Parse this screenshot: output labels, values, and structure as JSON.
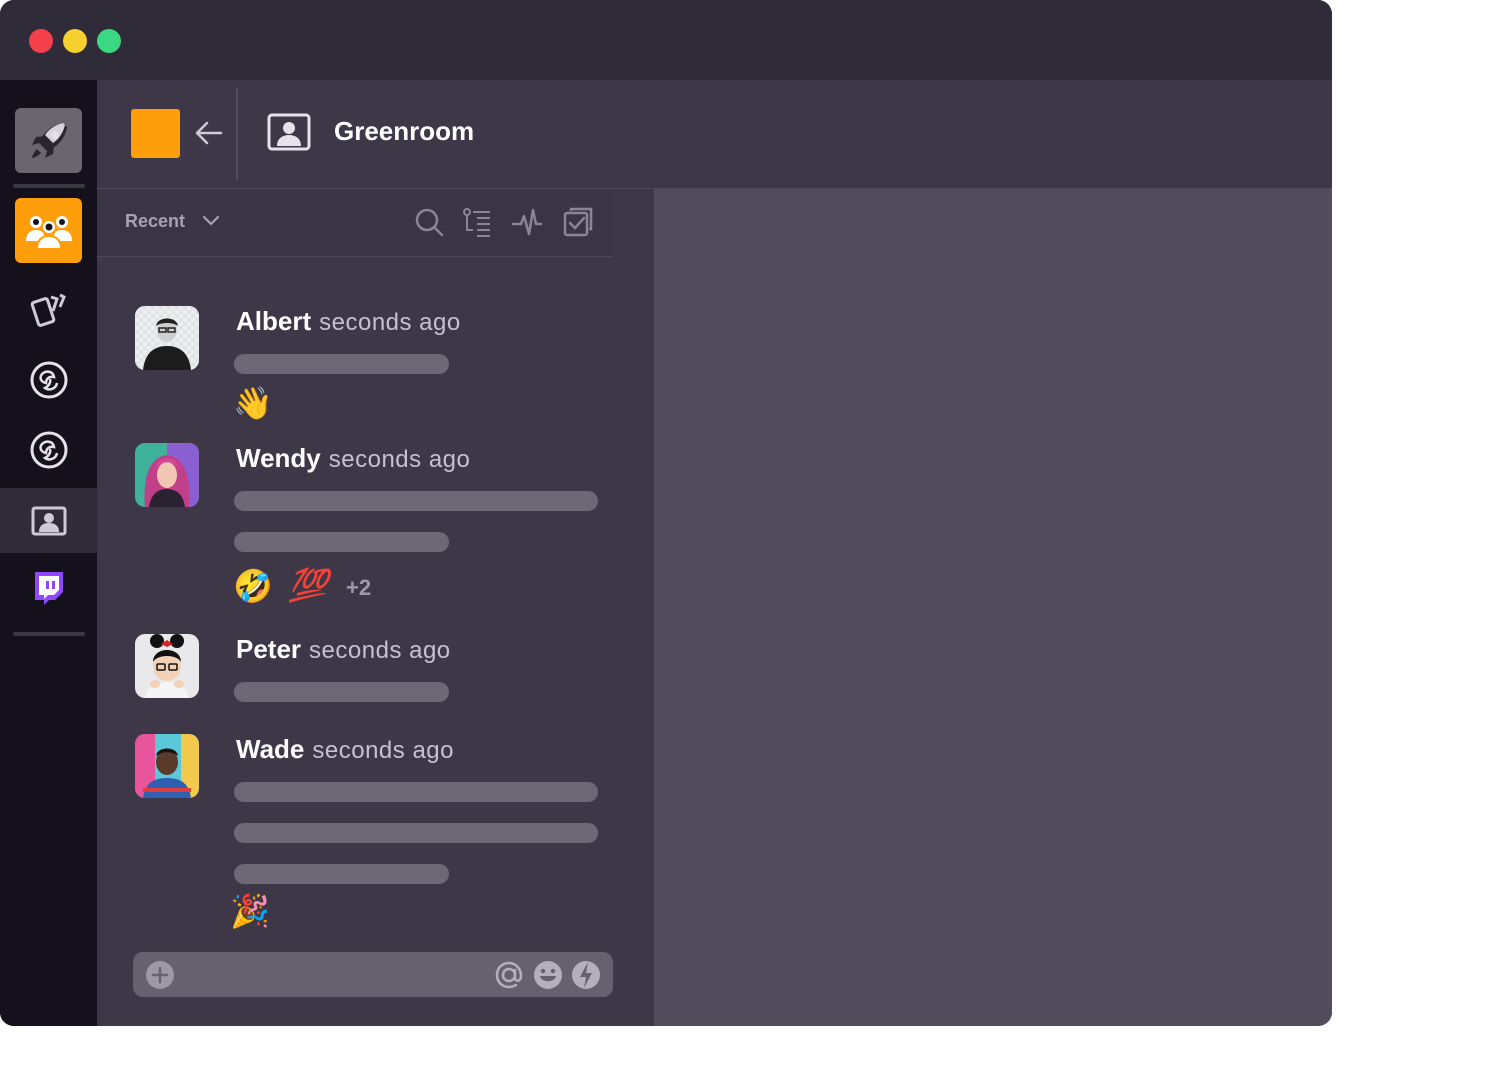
{
  "app": {
    "window_controls": [
      "close",
      "minimize",
      "maximize"
    ],
    "colors": {
      "accent": "#ff9e0b",
      "twitch": "#9147ff",
      "rail": "#14111d",
      "panel": "#3d3748",
      "main": "#524c5c"
    }
  },
  "rail": {
    "items": [
      {
        "name": "rocket-icon",
        "active": false
      },
      {
        "name": "team-icon",
        "active": true
      },
      {
        "name": "cards-icon",
        "active": false
      },
      {
        "name": "obs-icon",
        "active": false
      },
      {
        "name": "obs-icon",
        "active": false
      },
      {
        "name": "greenroom-icon",
        "active": true
      },
      {
        "name": "twitch-icon",
        "active": false
      }
    ]
  },
  "header": {
    "title": "Greenroom"
  },
  "toolbar": {
    "filter_label": "Recent",
    "icons": [
      "search-icon",
      "threads-icon",
      "activity-icon",
      "tasks-icon"
    ]
  },
  "messages": [
    {
      "author": "Albert",
      "time": "seconds ago",
      "reactions": [
        "👋"
      ],
      "more": ""
    },
    {
      "author": "Wendy",
      "time": "seconds ago",
      "reactions": [
        "🤣",
        "💯"
      ],
      "more": "+2"
    },
    {
      "author": "Peter",
      "time": "seconds ago",
      "reactions": [],
      "more": ""
    },
    {
      "author": "Wade",
      "time": "seconds ago",
      "reactions": [
        "🎉"
      ],
      "more": ""
    }
  ],
  "composer": {
    "icons": [
      "add-icon",
      "mention-icon",
      "emoji-icon",
      "lightning-icon"
    ]
  }
}
